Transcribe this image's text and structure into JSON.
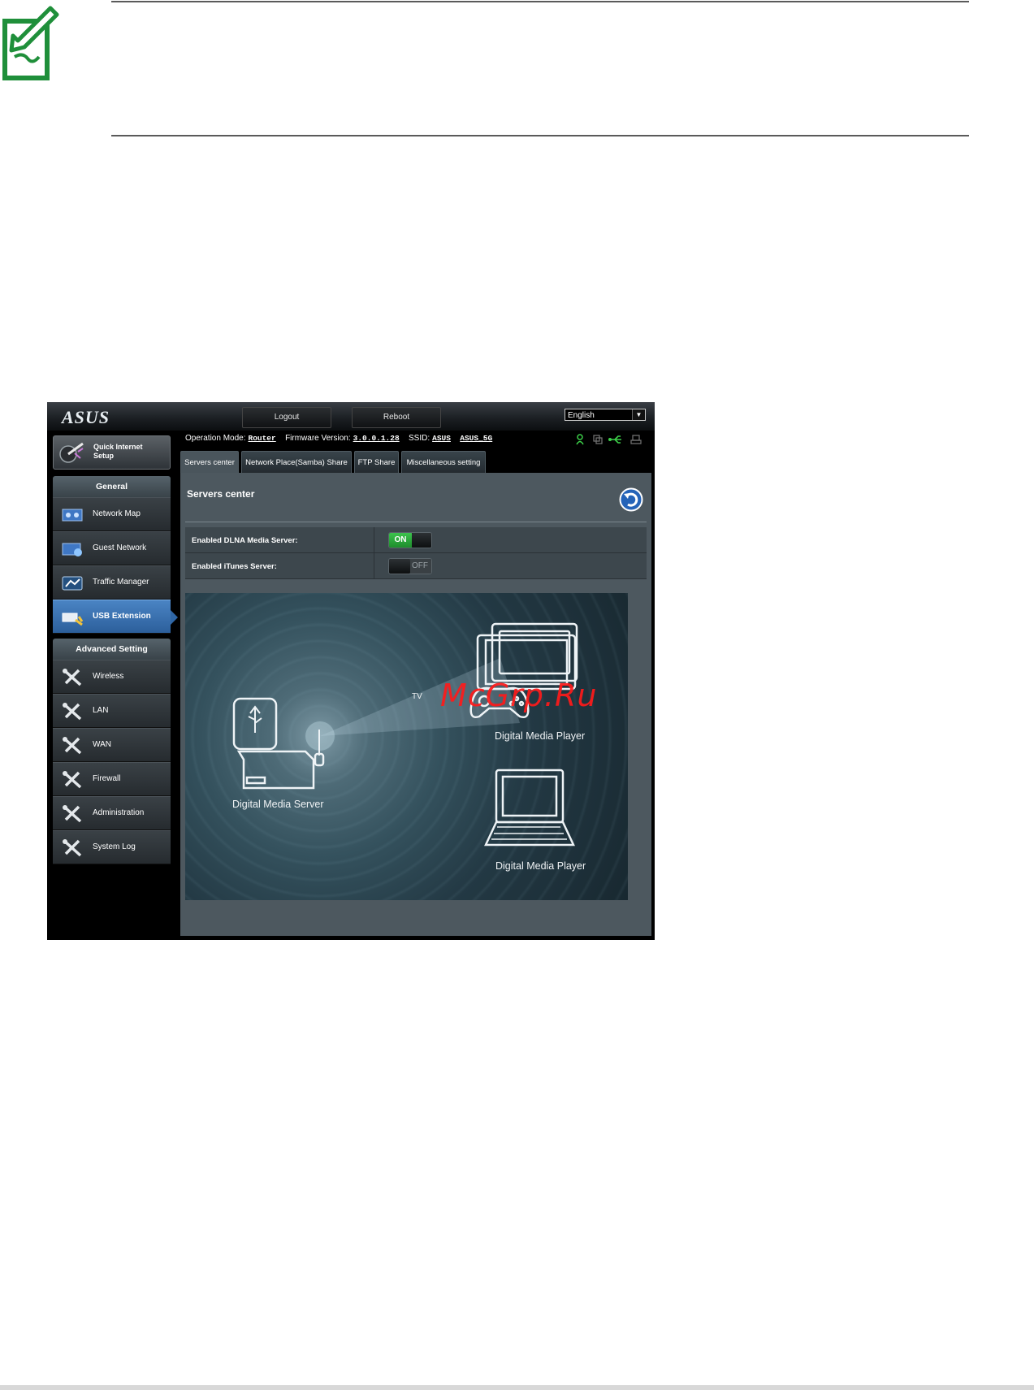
{
  "header": {
    "logo": "ASUS",
    "logout_label": "Logout",
    "reboot_label": "Reboot",
    "language_selected": "English"
  },
  "quick_setup": {
    "label_line1": "Quick Internet",
    "label_line2": "Setup"
  },
  "sidebar": {
    "general_header": "General",
    "general_items": [
      "Network Map",
      "Guest Network",
      "Traffic Manager",
      "USB Extension"
    ],
    "advanced_header": "Advanced Setting",
    "advanced_items": [
      "Wireless",
      "LAN",
      "WAN",
      "Firewall",
      "Administration",
      "System Log"
    ],
    "active_item": "USB Extension"
  },
  "status": {
    "op_mode_label": "Operation Mode:",
    "op_mode_value": "Router",
    "firmware_label": "Firmware Version:",
    "firmware_value": "3.0.0.1.28",
    "ssid_label": "SSID:",
    "ssid_1": "ASUS",
    "ssid_2": "ASUS_5G"
  },
  "tabs": [
    "Servers center",
    "Network Place(Samba) Share",
    "FTP Share",
    "Miscellaneous setting"
  ],
  "panel": {
    "title": "Servers center",
    "settings": [
      {
        "label": "Enabled DLNA Media Server:",
        "state": "ON"
      },
      {
        "label": "Enabled iTunes Server:",
        "state": "OFF"
      }
    ]
  },
  "diagram": {
    "server_label": "Digital  Media Server",
    "player1_label": "Digital  Media Player",
    "player2_label": "Digital  Media Player",
    "tv_label": "TV"
  },
  "watermark": "McGrp.Ru",
  "colors": {
    "accent_green": "#2fa93c",
    "active_nav": "#3a73b3",
    "watermark": "#ff1a1a"
  }
}
